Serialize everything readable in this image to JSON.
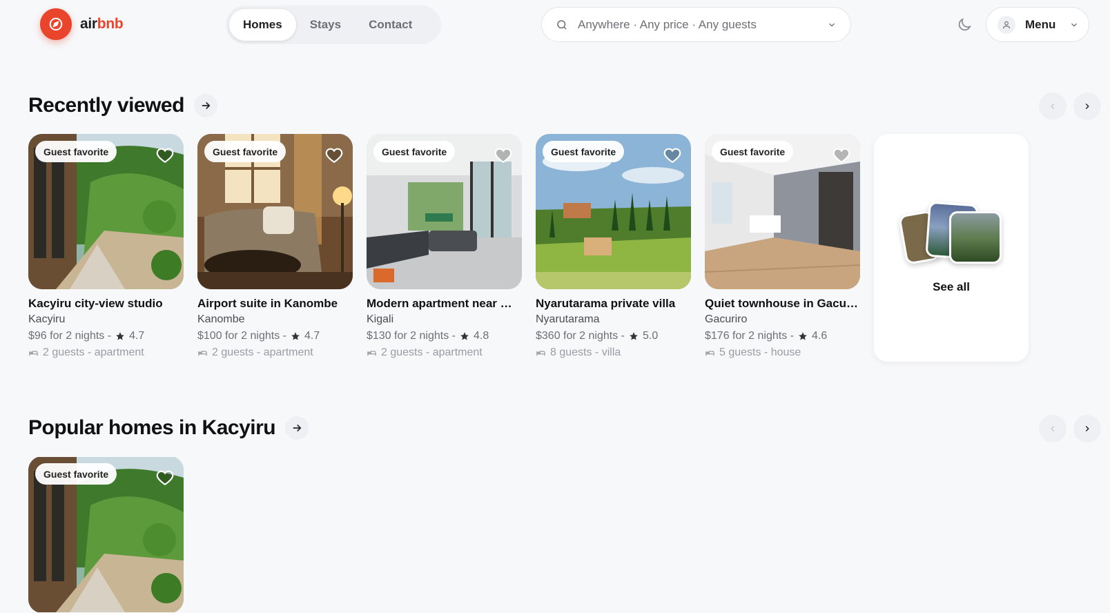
{
  "brand": {
    "part1": "air",
    "part2": "bnb",
    "accent": "#e8452c"
  },
  "nav": {
    "items": [
      {
        "label": "Homes",
        "active": true
      },
      {
        "label": "Stays"
      },
      {
        "label": "Contact"
      }
    ]
  },
  "search": {
    "text": "Anywhere · Any price · Any guests"
  },
  "menu": {
    "label": "Menu"
  },
  "sections": {
    "recent": {
      "title": "Recently viewed",
      "see_all": "See all",
      "cards": [
        {
          "badge": "Guest favorite",
          "title": "Kacyiru city-view studio",
          "location": "Kacyiru",
          "price": "$96 for 2 nights -",
          "rating": "4.7",
          "meta": "2 guests - apartment"
        },
        {
          "badge": "Guest favorite",
          "title": "Airport suite in Kanombe",
          "location": "Kanombe",
          "price": "$100 for 2 nights -",
          "rating": "4.7",
          "meta": "2 guests - apartment"
        },
        {
          "badge": "Guest favorite",
          "title": "Modern apartment near …",
          "location": "Kigali",
          "price": "$130 for 2 nights -",
          "rating": "4.8",
          "meta": "2 guests - apartment"
        },
        {
          "badge": "Guest favorite",
          "title": "Nyarutarama private villa",
          "location": "Nyarutarama",
          "price": "$360 for 2 nights -",
          "rating": "5.0",
          "meta": "8 guests - villa"
        },
        {
          "badge": "Guest favorite",
          "title": "Quiet townhouse in Gacur…",
          "location": "Gacuriro",
          "price": "$176 for 2 nights -",
          "rating": "4.6",
          "meta": "5 guests - house"
        }
      ]
    },
    "popular": {
      "title": "Popular homes in Kacyiru",
      "cards": [
        {
          "badge": "Guest favorite"
        }
      ]
    }
  }
}
